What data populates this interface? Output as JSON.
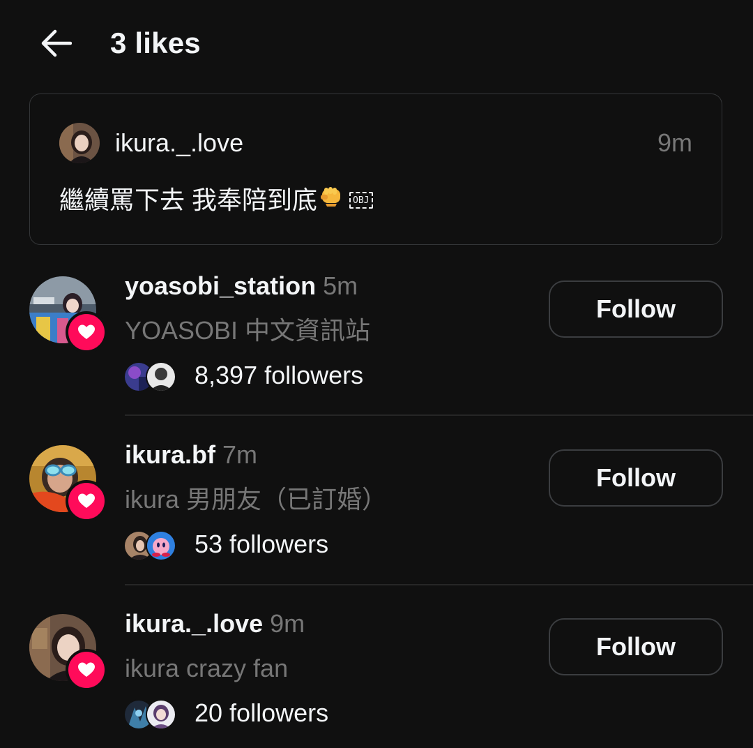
{
  "header": {
    "title": "3 likes",
    "back_icon": "arrow-left-icon"
  },
  "post": {
    "username": "ikura._.love",
    "time": "9m",
    "text": "繼續罵下去 我奉陪到底",
    "emoji": "👊",
    "obj_placeholder": "OBJ"
  },
  "likes": [
    {
      "username": "yoasobi_station",
      "time": "5m",
      "bio": "YOASOBI 中文資訊站",
      "followers": "8,397 followers",
      "follow_label": "Follow"
    },
    {
      "username": "ikura.bf",
      "time": "7m",
      "bio": "ikura 男朋友（已訂婚）",
      "followers": "53 followers",
      "follow_label": "Follow"
    },
    {
      "username": "ikura._.love",
      "time": "9m",
      "bio": "ikura crazy fan",
      "followers": "20 followers",
      "follow_label": "Follow"
    }
  ],
  "colors": {
    "background": "#101010",
    "text_primary": "#f3f5f7",
    "text_secondary": "#777777",
    "like_badge": "#ff0b5a",
    "border": "#343638"
  }
}
